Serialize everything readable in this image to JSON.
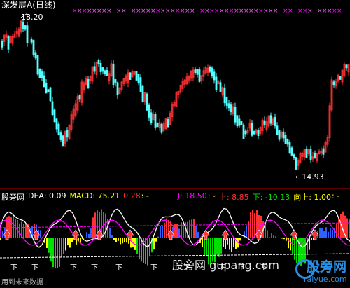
{
  "stock": {
    "title": "深发展A(日线)",
    "high_label": "18.20",
    "low_label": "←14.93"
  },
  "indicator": {
    "name": "股旁网",
    "dea": "DEA: 0.09",
    "macd": "MACD: 75.21",
    "v1": "0.28",
    "v2": ": -",
    "j": "J: 18.50",
    "sep": ": -",
    "up": "上: 8.85",
    "down": "下: -10.13",
    "up2": "向上: 1.00",
    "tail": ": -"
  },
  "watermark": "股旁网 gupang.com",
  "footer": "用到未来数据",
  "logo": {
    "big": "股旁网",
    "small": "raiyue.com"
  },
  "colors": {
    "up": "#ff3232",
    "down": "#54ffff",
    "text_white": "#ffffff",
    "yellow": "#ffff00",
    "magenta": "#ff00ff",
    "green": "#00e000",
    "blue": "#3060ff",
    "divider": "#c00000"
  }
}
